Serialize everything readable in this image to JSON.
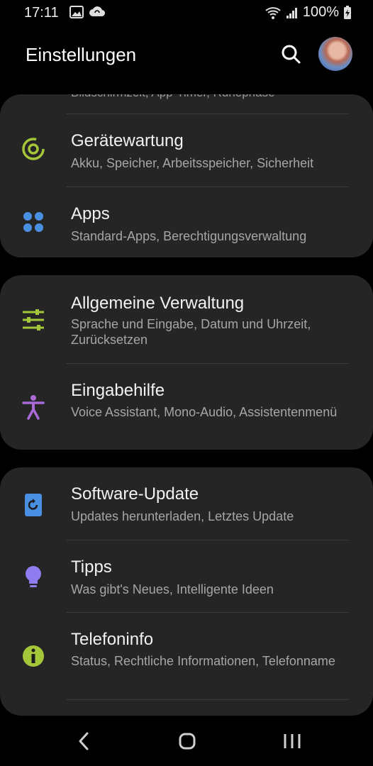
{
  "status_bar": {
    "time": "17:11",
    "battery": "100%",
    "icons": [
      "image-icon",
      "cloud-sync-icon",
      "wifi-icon",
      "signal-icon",
      "battery-charging-icon"
    ]
  },
  "header": {
    "title": "Einstellungen",
    "search_icon": "search-icon",
    "avatar": "avatar"
  },
  "clipped_item": {
    "subtitle": "Bildschirmzeit, App-Timer, Ruhephase"
  },
  "groups": [
    {
      "items": [
        {
          "title": "Gerätewartung",
          "subtitle": "Akku, Speicher, Arbeitsspeicher, Sicherheit",
          "icon": "device-care-icon",
          "color": "#a4c639"
        },
        {
          "title": "Apps",
          "subtitle": "Standard-Apps, Berechtigungsverwaltung",
          "icon": "apps-icon",
          "color": "#4a90e2"
        }
      ]
    },
    {
      "items": [
        {
          "title": "Allgemeine Verwaltung",
          "subtitle": "Sprache und Eingabe, Datum und Uhrzeit, Zurücksetzen",
          "icon": "sliders-icon",
          "color": "#a4c639"
        },
        {
          "title": "Eingabehilfe",
          "subtitle": "Voice Assistant, Mono-Audio, Assistentenmenü",
          "icon": "accessibility-icon",
          "color": "#a96ad6"
        }
      ]
    },
    {
      "items": [
        {
          "title": "Software-Update",
          "subtitle": "Updates herunterladen, Letztes Update",
          "icon": "software-update-icon",
          "color": "#4a90e2"
        },
        {
          "title": "Tipps",
          "subtitle": "Was gibt's Neues, Intelligente Ideen",
          "icon": "lightbulb-icon",
          "color": "#8e7cf0"
        },
        {
          "title": "Telefoninfo",
          "subtitle": "Status, Rechtliche Informationen, Telefonname",
          "icon": "info-icon",
          "color": "#a4c639"
        }
      ]
    }
  ],
  "navbar": {
    "icons": [
      "back-icon",
      "home-icon",
      "recents-icon"
    ]
  }
}
